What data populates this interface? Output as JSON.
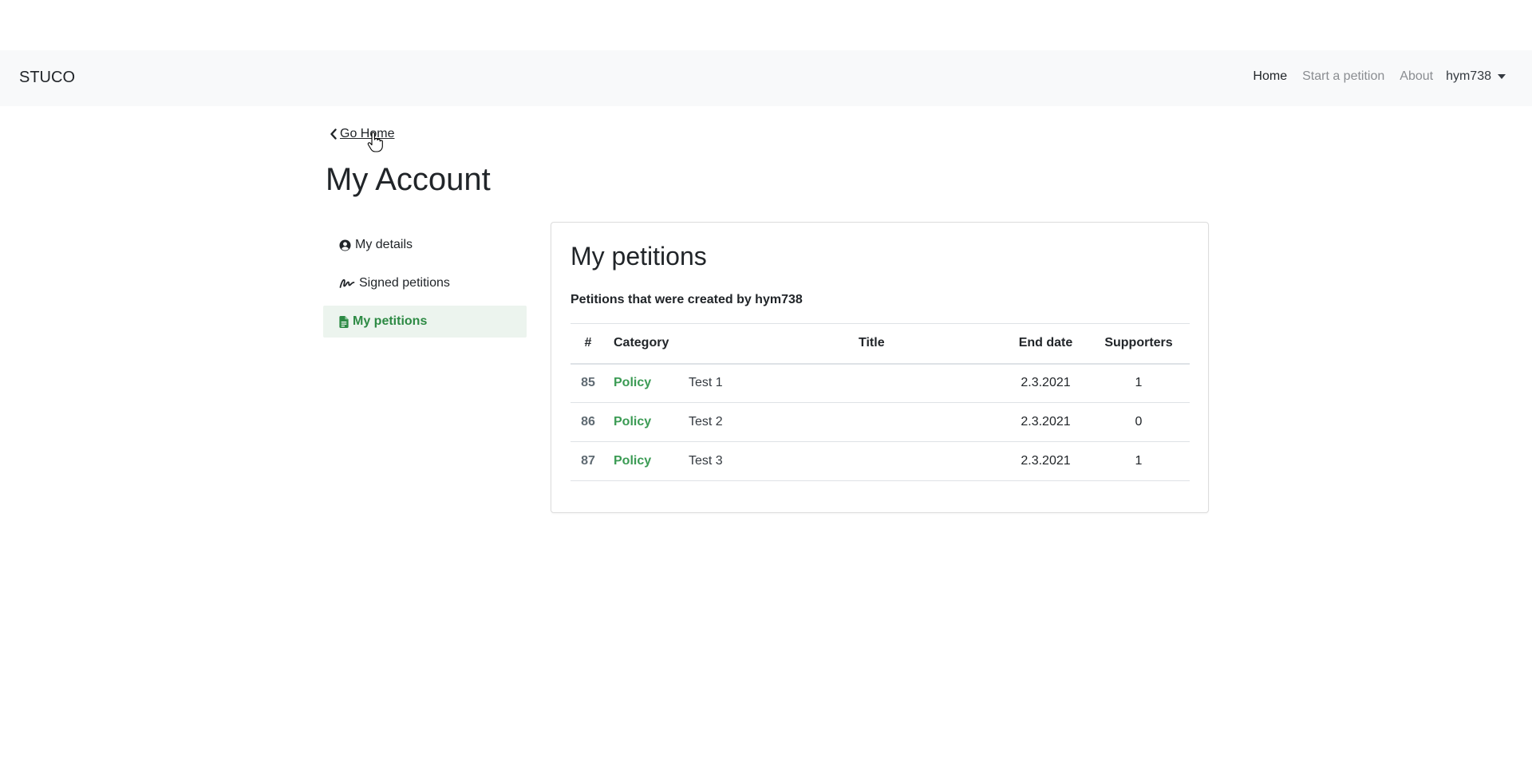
{
  "navbar": {
    "brand": "STUCO",
    "links": [
      "Home",
      "Start a petition",
      "About"
    ],
    "user": "hym738"
  },
  "back_link": "Go Home",
  "page_title": "My Account",
  "sidebar": {
    "items": [
      {
        "label": "My details",
        "icon": "user-circle-icon"
      },
      {
        "label": "Signed petitions",
        "icon": "signature-icon"
      },
      {
        "label": "My petitions",
        "icon": "document-icon",
        "active": true
      }
    ]
  },
  "card": {
    "title": "My petitions",
    "subtitle": "Petitions that were created by hym738",
    "columns": [
      "#",
      "Category",
      "Title",
      "End date",
      "Supporters"
    ],
    "rows": [
      {
        "id": "85",
        "category": "Policy",
        "title": "Test 1",
        "end_date": "2.3.2021",
        "supporters": "1"
      },
      {
        "id": "86",
        "category": "Policy",
        "title": "Test 2",
        "end_date": "2.3.2021",
        "supporters": "0"
      },
      {
        "id": "87",
        "category": "Policy",
        "title": "Test 3",
        "end_date": "2.3.2021",
        "supporters": "1"
      }
    ]
  },
  "colors": {
    "navbar_bg": "#f8f9fa",
    "accent_green": "#2d8a44",
    "active_bg": "#ecf4ee"
  }
}
